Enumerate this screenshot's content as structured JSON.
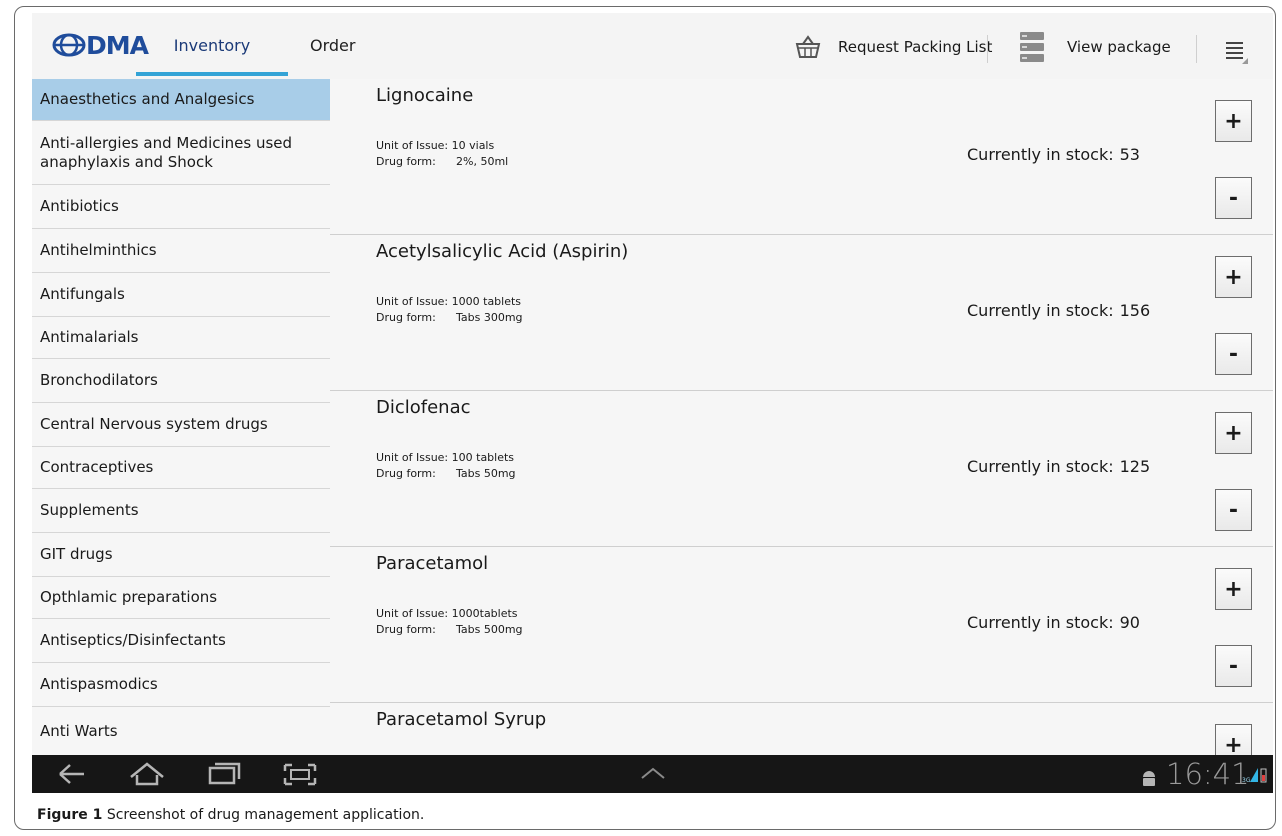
{
  "app": {
    "logo": "DMA",
    "tabs": {
      "inventory": "Inventory",
      "order": "Order"
    },
    "actions": {
      "request_packing_list": "Request Packing List",
      "view_package": "View package"
    }
  },
  "categories": [
    "Anaesthetics and Analgesics",
    "Anti-allergies and Medicines used anaphylaxis and Shock",
    "Antibiotics",
    "Antihelminthics",
    "Antifungals",
    "Antimalarials",
    "Bronchodilators",
    "Central Nervous system drugs",
    "Contraceptives",
    "Supplements",
    "GIT drugs",
    "Opthlamic preparations",
    "Antiseptics/Disinfectants",
    "Antispasmodics",
    "Anti Warts"
  ],
  "selected_category": "Anaesthetics and Analgesics",
  "drugs": [
    {
      "name": "Lignocaine",
      "unit": "Unit of Issue: 10 vials",
      "form_label": "Drug form:",
      "form": "2%, 50ml",
      "stock_label": "Currently in stock:",
      "stock": "53",
      "plus": "+",
      "minus": "-"
    },
    {
      "name": "Acetylsalicylic Acid (Aspirin)",
      "unit": "Unit of Issue: 1000 tablets",
      "form_label": "Drug form:",
      "form": "Tabs 300mg",
      "stock_label": "Currently in stock:",
      "stock": "156",
      "plus": "+",
      "minus": "-"
    },
    {
      "name": "Diclofenac",
      "unit": "Unit of Issue: 100 tablets",
      "form_label": "Drug form:",
      "form": "Tabs 50mg",
      "stock_label": "Currently in stock:",
      "stock": "125",
      "plus": "+",
      "minus": "-"
    },
    {
      "name": "Paracetamol",
      "unit": "Unit of Issue: 1000tablets",
      "form_label": "Drug form:",
      "form": "Tabs 500mg",
      "stock_label": "Currently in stock:",
      "stock": "90",
      "plus": "+",
      "minus": "-"
    },
    {
      "name": "Paracetamol Syrup",
      "plus": "+"
    }
  ],
  "status_bar": {
    "time": "16:41",
    "network": "3G"
  },
  "caption": {
    "label": "Figure 1",
    "text": "Screenshot of drug management application."
  },
  "colors": {
    "accent": "#33a3d6",
    "selected": "#a8cde8",
    "logo": "#1f4c9b",
    "navbar": "#161616"
  }
}
